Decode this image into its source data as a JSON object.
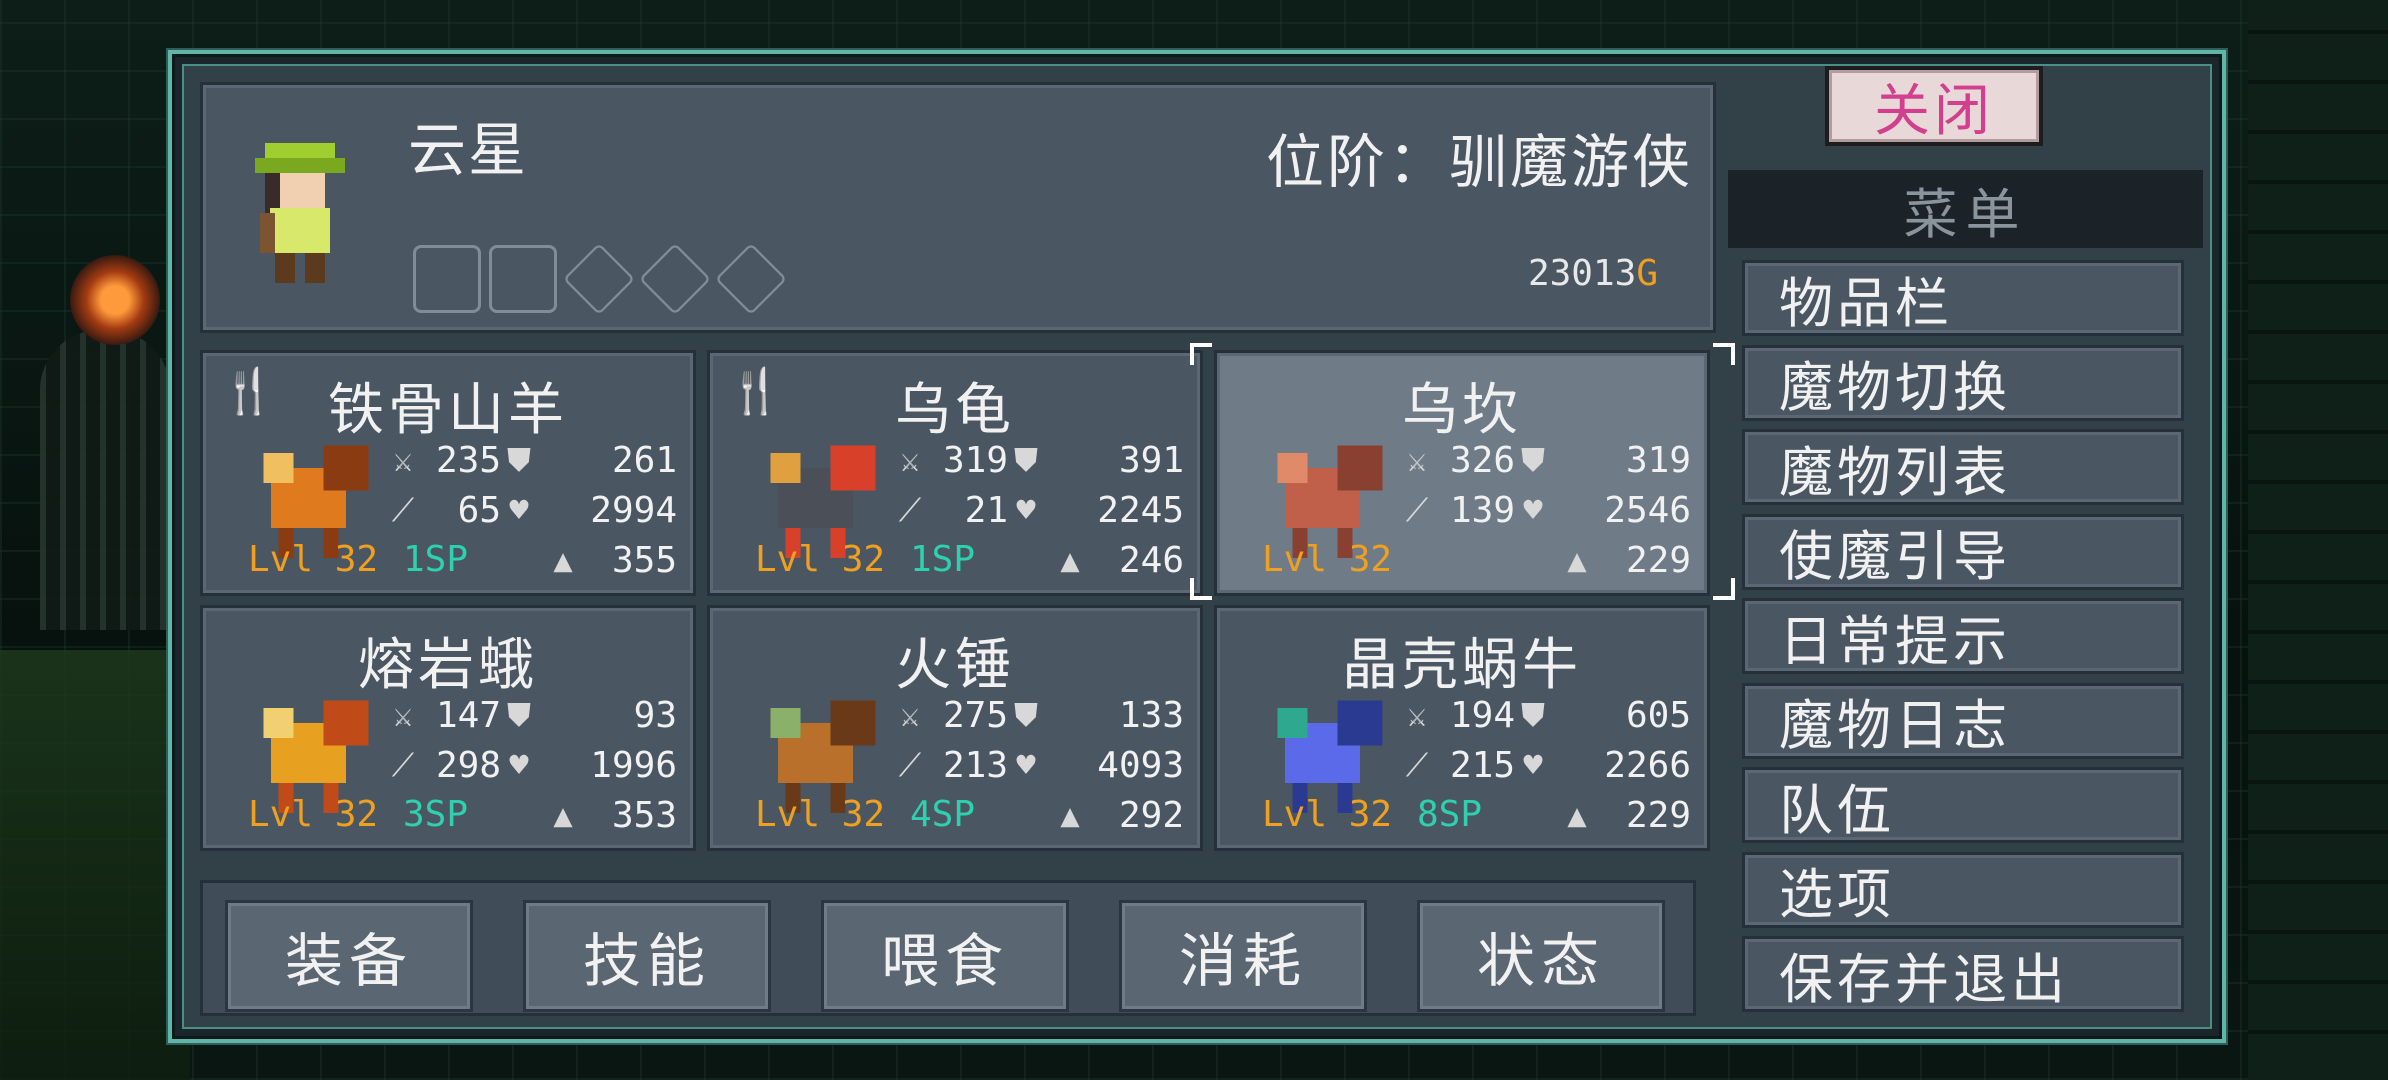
{
  "player": {
    "name": "云星",
    "rank": "位阶：驯魔游侠",
    "gold_amount": "23013",
    "gold_suffix": "G"
  },
  "close_label": "关闭",
  "menu": {
    "title": "菜单",
    "items": [
      "物品栏",
      "魔物切换",
      "魔物列表",
      "使魔引导",
      "日常提示",
      "魔物日志",
      "队伍",
      "选项",
      "保存并退出"
    ]
  },
  "monsters": [
    {
      "name": "铁骨山羊",
      "attack": "235",
      "defense": "261",
      "magic": "65",
      "health": "2994",
      "food": "355",
      "level": "Lvl 32",
      "sp": "1SP",
      "feedable": true
    },
    {
      "name": "乌龟",
      "attack": "319",
      "defense": "391",
      "magic": "21",
      "health": "2245",
      "food": "246",
      "level": "Lvl 32",
      "sp": "1SP",
      "feedable": true
    },
    {
      "name": "乌坎",
      "attack": "326",
      "defense": "319",
      "magic": "139",
      "health": "2546",
      "food": "229",
      "level": "Lvl 32",
      "sp": "",
      "feedable": false
    },
    {
      "name": "熔岩蛾",
      "attack": "147",
      "defense": "93",
      "magic": "298",
      "health": "1996",
      "food": "353",
      "level": "Lvl 32",
      "sp": "3SP",
      "feedable": false
    },
    {
      "name": "火锤",
      "attack": "275",
      "defense": "133",
      "magic": "213",
      "health": "4093",
      "food": "292",
      "level": "Lvl 32",
      "sp": "4SP",
      "feedable": false
    },
    {
      "name": "晶壳蜗牛",
      "attack": "194",
      "defense": "605",
      "magic": "215",
      "health": "2266",
      "food": "229",
      "level": "Lvl 32",
      "sp": "8SP",
      "feedable": false
    }
  ],
  "actions": [
    "装备",
    "技能",
    "喂食",
    "消耗",
    "状态"
  ],
  "colors": {
    "accent_frame": "#5fb6a8",
    "level": "#f0a020",
    "sp": "#2fd0b0",
    "close_text": "#d23f8f",
    "gold_g": "#f0a020"
  },
  "icons": {
    "attack": "sword-icon",
    "defense": "shield-icon",
    "magic": "wand-icon",
    "health": "heart-icon",
    "food": "food-pile-icon",
    "feed": "fork-knife-icon"
  }
}
